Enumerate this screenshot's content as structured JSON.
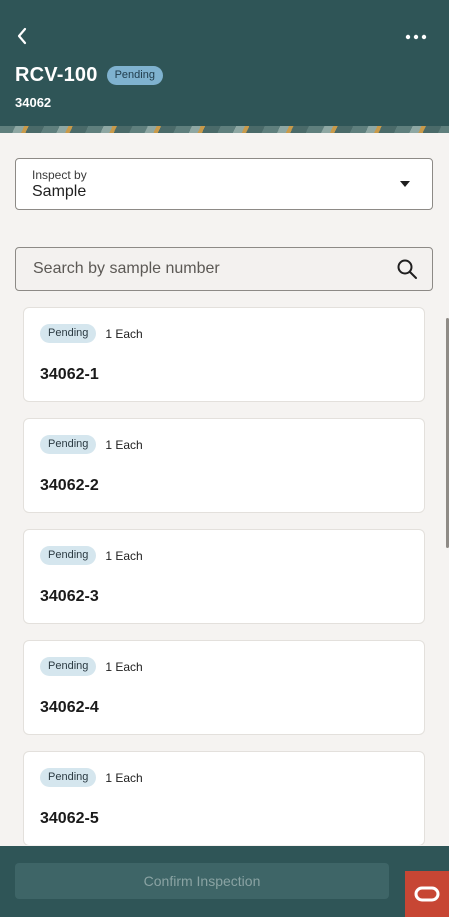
{
  "header": {
    "title": "RCV-100",
    "status": "Pending",
    "subtitle": "34062"
  },
  "inspect": {
    "label": "Inspect by",
    "value": "Sample"
  },
  "search": {
    "placeholder": "Search by sample number"
  },
  "samples": [
    {
      "status": "Pending",
      "quantity": "1 Each",
      "id": "34062-1"
    },
    {
      "status": "Pending",
      "quantity": "1 Each",
      "id": "34062-2"
    },
    {
      "status": "Pending",
      "quantity": "1 Each",
      "id": "34062-3"
    },
    {
      "status": "Pending",
      "quantity": "1 Each",
      "id": "34062-4"
    },
    {
      "status": "Pending",
      "quantity": "1 Each",
      "id": "34062-5"
    }
  ],
  "footer": {
    "confirm_label": "Confirm Inspection"
  },
  "colors": {
    "header_bg": "#2f5557",
    "pending_badge": "#d5e6ee",
    "oracle_red": "#c74634"
  }
}
